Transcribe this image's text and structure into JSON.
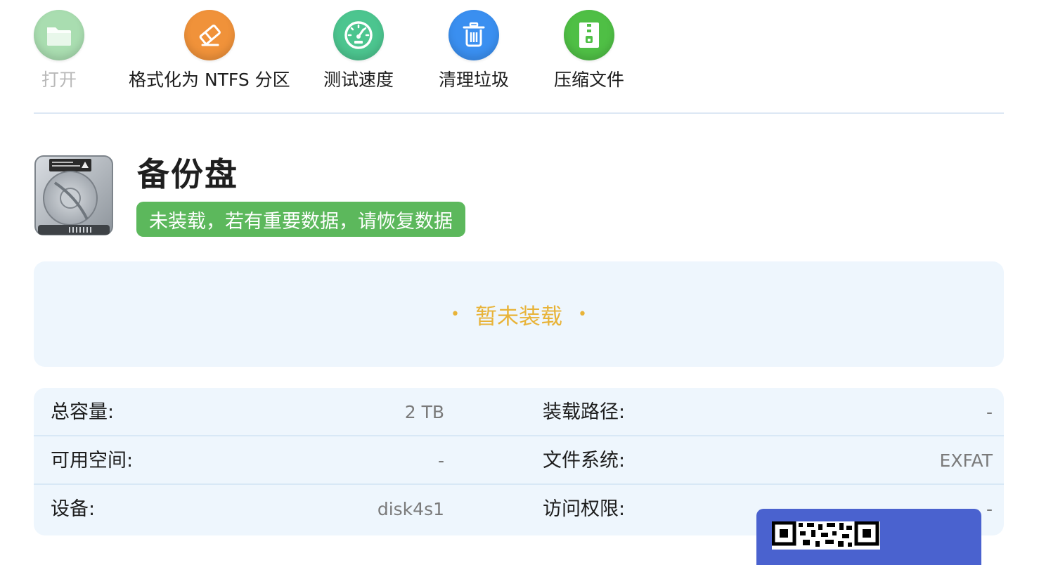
{
  "toolbar": {
    "items": [
      {
        "label": "打开",
        "icon": "folder-icon",
        "color": "#a9ddb0",
        "disabled": true
      },
      {
        "label": "格式化为 NTFS 分区",
        "icon": "eraser-icon",
        "color": "#f0923a",
        "disabled": false
      },
      {
        "label": "测试速度",
        "icon": "speedometer-icon",
        "color": "#4cc58f",
        "disabled": false
      },
      {
        "label": "清理垃圾",
        "icon": "trash-icon",
        "color": "#3a8ff0",
        "disabled": false
      },
      {
        "label": "压缩文件",
        "icon": "zip-icon",
        "color": "#4fbf45",
        "disabled": false
      }
    ]
  },
  "disk": {
    "name": "备份盘",
    "status": "未装载，若有重要数据，请恢复数据",
    "icon": "hard-drive-icon"
  },
  "mount": {
    "text": "暂未装载",
    "dot": "•"
  },
  "info": {
    "rows": [
      {
        "left_label": "总容量:",
        "left_value": "2 TB",
        "right_label": "装载路径:",
        "right_value": "-"
      },
      {
        "left_label": "可用空间:",
        "left_value": "-",
        "right_label": "文件系统:",
        "right_value": "EXFAT"
      },
      {
        "left_label": "设备:",
        "left_value": "disk4s1",
        "right_label": "访问权限:",
        "right_value": "-"
      }
    ]
  },
  "colors": {
    "status_badge": "#5cb85c",
    "mount_text": "#e8b338",
    "panel_bg": "#eef6fd",
    "qr_popup": "#4a62cf"
  }
}
